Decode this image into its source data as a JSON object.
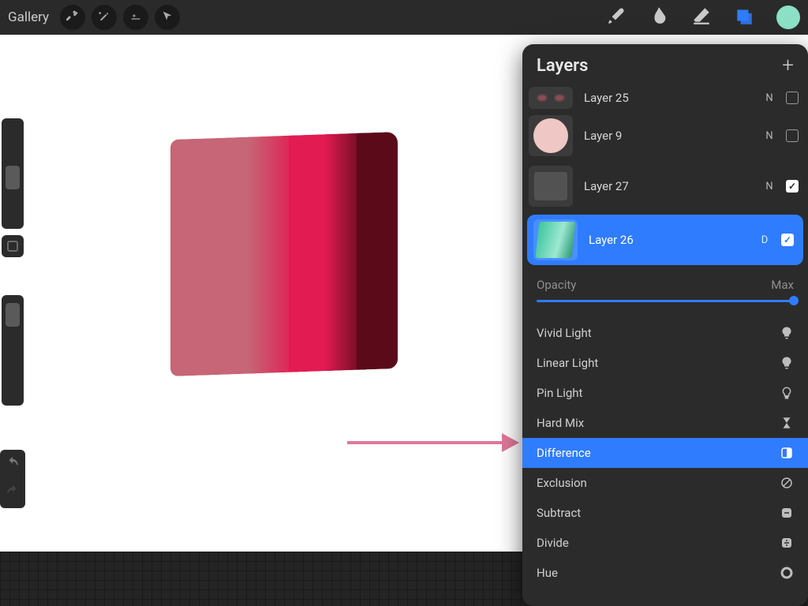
{
  "topbar": {
    "gallery_label": "Gallery",
    "color_swatch": "#8be0c5"
  },
  "layers_panel": {
    "title": "Layers",
    "layers": [
      {
        "name": "Layer 25",
        "blend_letter": "N",
        "visible": false
      },
      {
        "name": "Layer 9",
        "blend_letter": "N",
        "visible": false
      },
      {
        "name": "Layer 27",
        "blend_letter": "N",
        "visible": true
      },
      {
        "name": "Layer 26",
        "blend_letter": "D",
        "visible": true,
        "selected": true
      }
    ],
    "opacity": {
      "label": "Opacity",
      "value_label": "Max",
      "value": 1.0
    },
    "blend_modes": [
      {
        "name": "Vivid Light",
        "icon": "bulb-filled"
      },
      {
        "name": "Linear Light",
        "icon": "bulb-filled"
      },
      {
        "name": "Pin Light",
        "icon": "bulb-outline"
      },
      {
        "name": "Hard Mix",
        "icon": "hourglass"
      },
      {
        "name": "Difference",
        "icon": "half-square",
        "selected": true
      },
      {
        "name": "Exclusion",
        "icon": "diag-circle"
      },
      {
        "name": "Subtract",
        "icon": "minus-square"
      },
      {
        "name": "Divide",
        "icon": "divide-square"
      },
      {
        "name": "Hue",
        "icon": "ring"
      }
    ]
  }
}
